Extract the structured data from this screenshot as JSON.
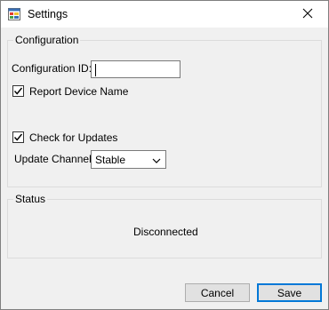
{
  "window": {
    "title": "Settings"
  },
  "configuration": {
    "legend": "Configuration",
    "config_id_label": "Configuration ID:",
    "config_id_value": "",
    "report_device_name_label": "Report Device Name",
    "report_device_name_checked": true,
    "check_for_updates_label": "Check for Updates",
    "check_for_updates_checked": true,
    "update_channel_label": "Update Channel:",
    "update_channel_value": "Stable"
  },
  "status": {
    "legend": "Status",
    "text": "Disconnected"
  },
  "buttons": {
    "cancel_label": "Cancel",
    "save_label": "Save"
  },
  "icons": {
    "app": "settings-app-icon",
    "close": "close-icon",
    "check": "check-icon",
    "dropdown": "chevron-down-icon"
  },
  "colors": {
    "accent": "#0078d7",
    "window_bg": "#f0f0f0",
    "titlebar_bg": "#ffffff"
  }
}
